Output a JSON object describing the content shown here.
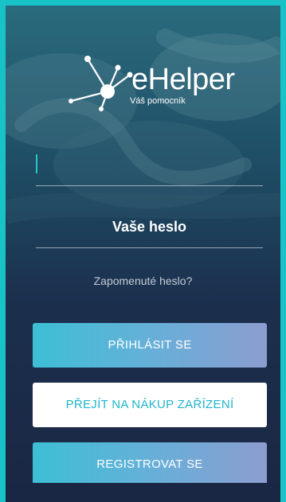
{
  "brand": {
    "name": "eHelper",
    "tagline": "Váš pomocník"
  },
  "form": {
    "username_value": "",
    "password_placeholder": "Vaše heslo",
    "forgot_password": "Zapomenuté heslo?"
  },
  "buttons": {
    "login": "PŘIHLÁSIT SE",
    "shop": "PŘEJÍT NA NÁKUP ZAŘÍZENÍ",
    "register": "REGISTROVAT SE"
  },
  "colors": {
    "frame": "#17c3c6",
    "accent": "#20b5cb",
    "gradient_start": "#3dbfd6",
    "gradient_end": "#8c9dd0",
    "background_dark": "#1a2744"
  }
}
